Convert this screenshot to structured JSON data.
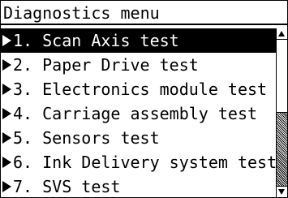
{
  "header": {
    "title": "Diagnostics menu"
  },
  "menu": {
    "items": [
      {
        "label": "1. Scan Axis test",
        "selected": true
      },
      {
        "label": "2. Paper Drive test",
        "selected": false
      },
      {
        "label": "3. Electronics module test",
        "selected": false
      },
      {
        "label": "4. Carriage assembly test",
        "selected": false
      },
      {
        "label": "5. Sensors test",
        "selected": false
      },
      {
        "label": "6. Ink Delivery system test",
        "selected": false
      },
      {
        "label": "7. SVS test",
        "selected": false
      }
    ]
  },
  "icons": {
    "item_marker": "right-pointer-icon",
    "scroll_up": "scroll-up-arrow-icon",
    "scroll_down": "scroll-down-arrow-icon"
  },
  "colors": {
    "foreground": "#000000",
    "background": "#ffffff",
    "selected_background": "#000000",
    "selected_foreground": "#ffffff"
  }
}
